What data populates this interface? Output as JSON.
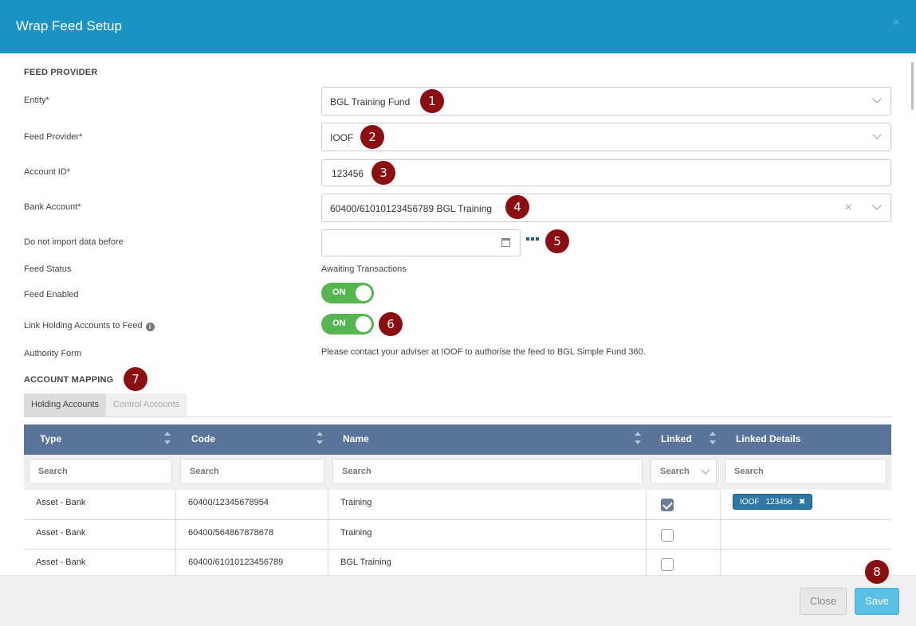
{
  "dialog": {
    "title": "Wrap Feed Setup",
    "close_glyph": "×"
  },
  "feed_provider": {
    "section_title": "FEED PROVIDER",
    "entity": {
      "label": "Entity*",
      "value": "BGL Training Fund"
    },
    "provider": {
      "label": "Feed Provider*",
      "value": "IOOF"
    },
    "account_id": {
      "label": "Account ID*",
      "value": "123456"
    },
    "bank_account": {
      "label": "Bank Account*",
      "value": "60400/61010123456789 BGL Training",
      "clear_glyph": "×"
    },
    "import_before": {
      "label": "Do not import data before",
      "value": ""
    },
    "feed_status": {
      "label": "Feed Status",
      "value": "Awaiting Transactions"
    },
    "feed_enabled": {
      "label": "Feed Enabled",
      "state": "ON"
    },
    "link_holding": {
      "label": "Link Holding Accounts to Feed",
      "info_glyph": "i",
      "state": "ON"
    },
    "authority_form": {
      "label": "Authority Form",
      "value": "Please contact your adviser at IOOF to authorise the feed to BGL Simple Fund 360."
    }
  },
  "account_mapping": {
    "section_title": "ACCOUNT MAPPING",
    "tabs": [
      {
        "label": "Holding Accounts",
        "active": true
      },
      {
        "label": "Control Accounts",
        "active": false
      }
    ],
    "columns": [
      "Type",
      "Code",
      "Name",
      "Linked",
      "Linked Details"
    ],
    "filters": [
      "Search",
      "Search",
      "Search",
      "Search",
      "Search"
    ],
    "rows": [
      {
        "type": "Asset - Bank",
        "code": "60400/12345678954",
        "name": "Training",
        "linked": true,
        "details": {
          "provider": "IOOF",
          "account": "123456",
          "remove_glyph": "✖"
        }
      },
      {
        "type": "Asset - Bank",
        "code": "60400/564867878678",
        "name": "Training",
        "linked": false
      },
      {
        "type": "Asset - Bank",
        "code": "60400/61010123456789",
        "name": "BGL Training",
        "linked": false
      }
    ]
  },
  "badges": [
    "1",
    "2",
    "3",
    "4",
    "5",
    "6",
    "7",
    "8"
  ],
  "footer": {
    "close_label": "Close",
    "save_label": "Save"
  },
  "colors": {
    "header": "#1a93c3",
    "table_header": "#5b7499",
    "toggle_on": "#55b64f",
    "badge": "#8b0f10",
    "save": "#5bc0e6"
  }
}
